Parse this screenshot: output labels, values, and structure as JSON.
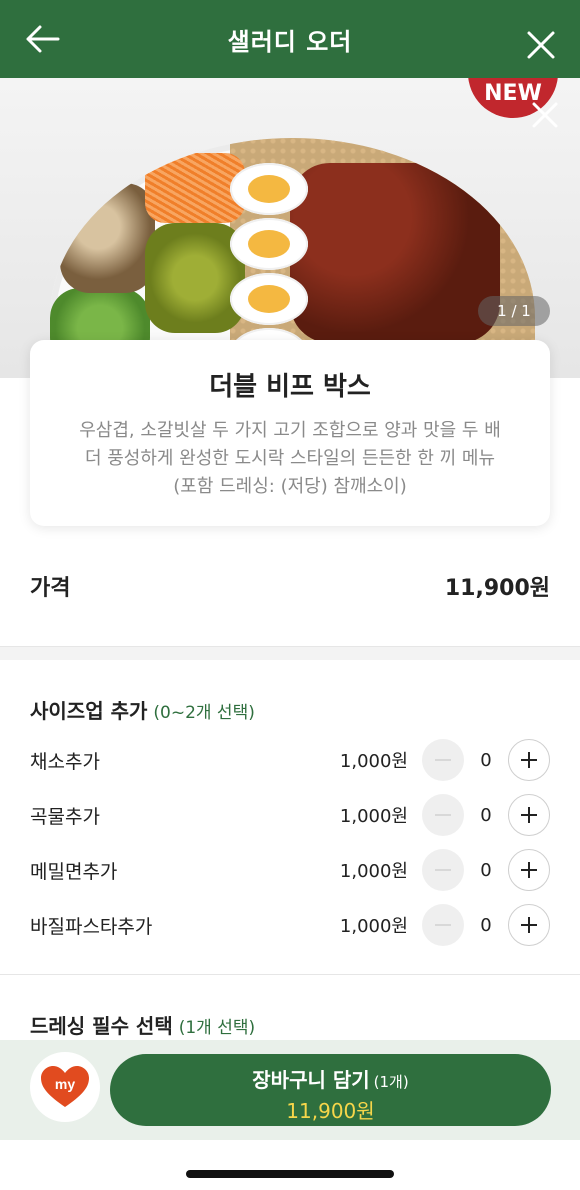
{
  "header": {
    "title": "샐러디 오더",
    "back_icon": "arrow-left-icon",
    "close_icon": "close-icon"
  },
  "hero": {
    "badge": "NEW",
    "pager": "1 / 1"
  },
  "product": {
    "name": "더블 비프 박스",
    "desc_line1": "우삼겹, 소갈빗살 두 가지 고기 조합으로 양과 맛을 두 배",
    "desc_line2": "더 풍성하게 완성한 도시락 스타일의 든든한 한 끼 메뉴",
    "desc_line3": "(포함 드레싱: (저당) 참깨소이)"
  },
  "price": {
    "label": "가격",
    "value": "11,900원"
  },
  "sizeup": {
    "title": "사이즈업 추가",
    "hint": "(0~2개 선택)",
    "options": [
      {
        "name": "채소추가",
        "price": "1,000원",
        "qty": "0"
      },
      {
        "name": "곡물추가",
        "price": "1,000원",
        "qty": "0"
      },
      {
        "name": "메밀면추가",
        "price": "1,000원",
        "qty": "0"
      },
      {
        "name": "바질파스타추가",
        "price": "1,000원",
        "qty": "0"
      }
    ]
  },
  "dressing": {
    "title": "드레싱 필수 선택",
    "hint": "(1개 선택)"
  },
  "bottom": {
    "my_label": "my",
    "cart_label": "장바구니 담기",
    "cart_count": "(1개)",
    "cart_total": "11,900원"
  },
  "colors": {
    "brand_green": "#2f6f3e",
    "accent_yellow": "#f6d64a",
    "new_red": "#c1272d"
  }
}
